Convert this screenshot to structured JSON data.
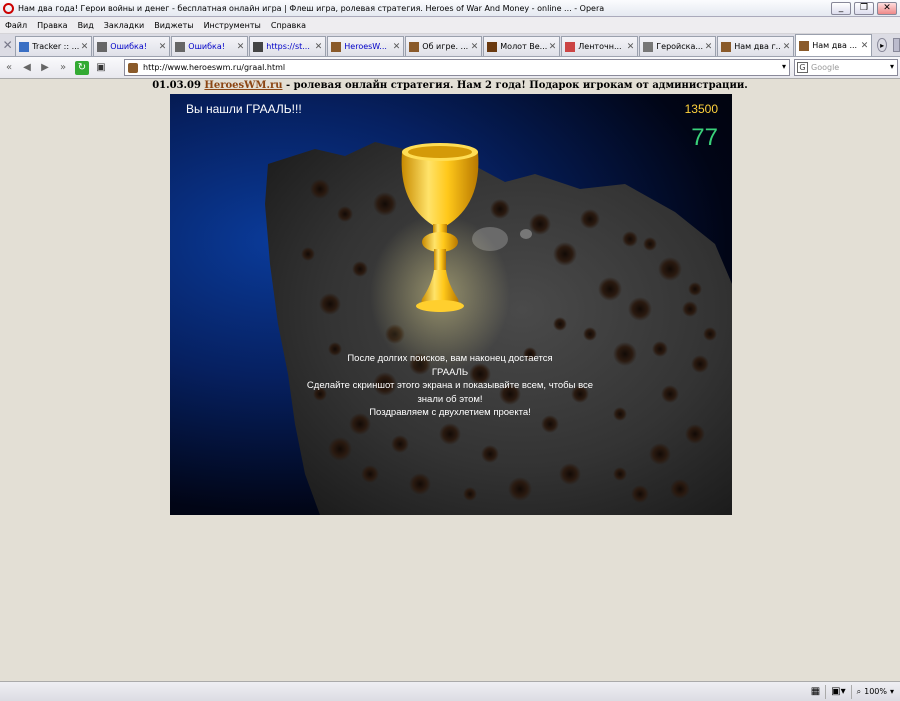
{
  "window": {
    "title": "Нам два года! Герои войны и денег - бесплатная онлайн игра | Флеш игра, ролевая стратегия. Heroes of War And Money - online ... - Opera",
    "minimize": "_",
    "restore": "❐",
    "close": "✕"
  },
  "menu": [
    "Файл",
    "Правка",
    "Вид",
    "Закладки",
    "Виджеты",
    "Инструменты",
    "Справка"
  ],
  "tabs": [
    {
      "label": "Tracker :: ...",
      "blue": false
    },
    {
      "label": "Ошибка!",
      "blue": true
    },
    {
      "label": "Ошибка!",
      "blue": true
    },
    {
      "label": "https://st...",
      "blue": true
    },
    {
      "label": "HeroesW...",
      "blue": true
    },
    {
      "label": "Об игре. ...",
      "blue": false
    },
    {
      "label": "Молот Ве...",
      "blue": false
    },
    {
      "label": "Ленточн...",
      "blue": false
    },
    {
      "label": "Геройска...",
      "blue": false
    },
    {
      "label": "Нам два г...",
      "blue": false
    },
    {
      "label": "Нам два ...",
      "blue": false
    }
  ],
  "address": {
    "url": "http://www.heroeswm.ru/graal.html",
    "search_placeholder": "Google"
  },
  "announce": {
    "date": "01.03.09",
    "link": "HeroesWM.ru",
    "text": " - ролевая онлайн стратегия. Нам 2 года! Подарок игрокам от администрации."
  },
  "game": {
    "found": "Вы нашли ГРААЛЬ!!!",
    "score": "13500",
    "counter": "77",
    "message": [
      "После долгих поисков, вам наконец достается",
      "ГРААЛЬ",
      "Сделайте скриншот этого экрана и показывайте всем, чтобы все",
      "знали об этом!",
      "Поздравляем с двухлетием проекта!"
    ]
  },
  "status": {
    "zoom": "100%"
  },
  "colors": {
    "score": "#ffd23c",
    "counter": "#3ad17a",
    "link": "#8b4513",
    "grail": "#f5c518"
  }
}
